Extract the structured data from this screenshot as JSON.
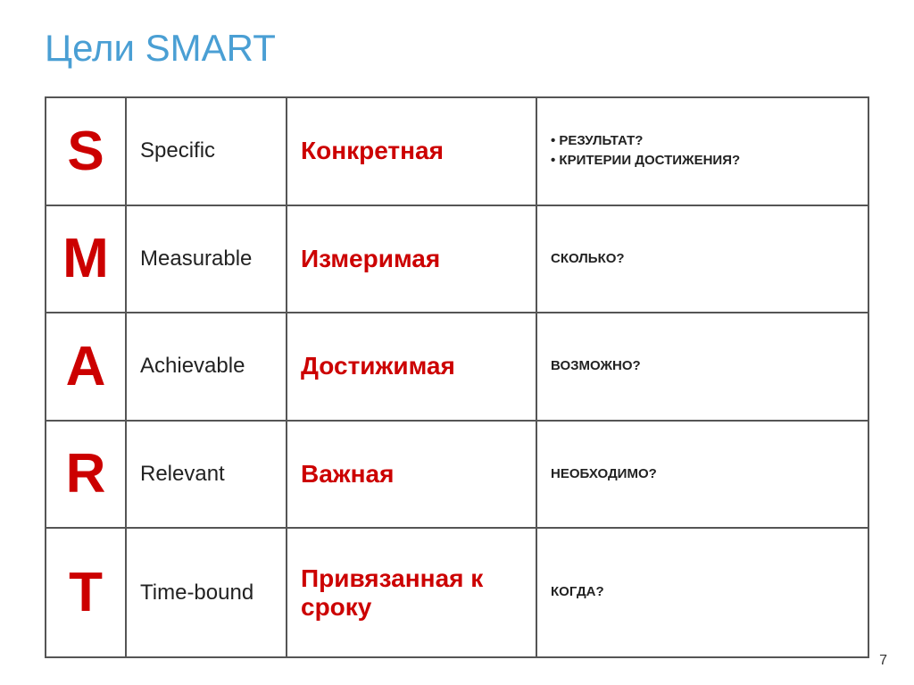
{
  "title": "Цели SMART",
  "rows": [
    {
      "letter": "S",
      "english": "Specific",
      "russian": "Конкретная",
      "question": "• РЕЗУЛЬТАТ?\n• КРИТЕРИИ ДОСТИЖЕНИЯ?"
    },
    {
      "letter": "M",
      "english": "Measurable",
      "russian": "Измеримая",
      "question": "СКОЛЬКО?"
    },
    {
      "letter": "A",
      "english": "Achievable",
      "russian": "Достижимая",
      "question": "ВОЗМОЖНО?"
    },
    {
      "letter": "R",
      "english": "Relevant",
      "russian": "Важная",
      "question": "НЕОБХОДИМО?"
    },
    {
      "letter": "T",
      "english": "Time-bound",
      "russian": "Привязанная к сроку",
      "question": "КОГДА?"
    }
  ],
  "page_number": "7"
}
